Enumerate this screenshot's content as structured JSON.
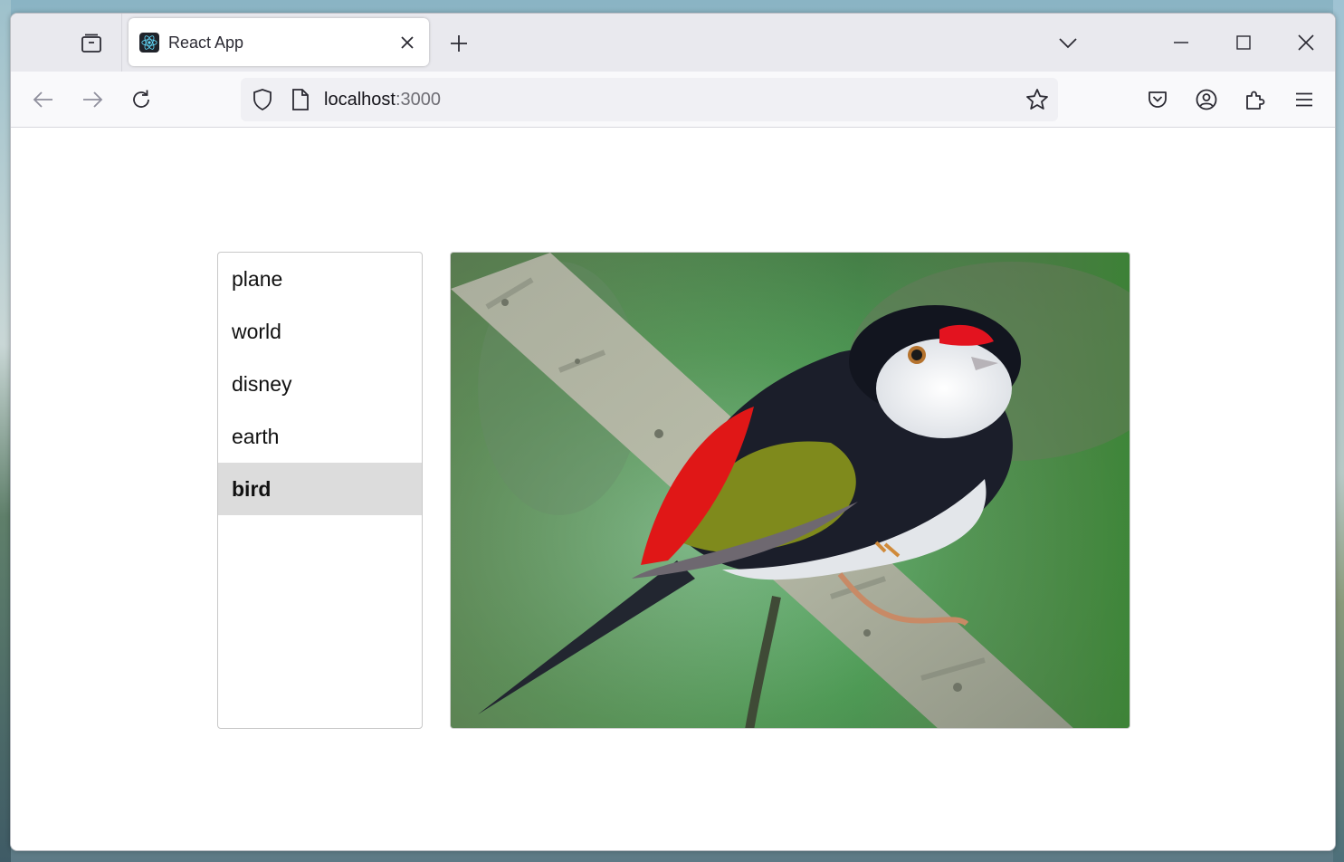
{
  "browser": {
    "tab": {
      "title": "React App",
      "favicon": "react-icon"
    },
    "url": {
      "host": "localhost",
      "port": ":3000"
    },
    "icons": [
      "tab-overview-icon",
      "close-icon",
      "plus-icon",
      "chevron-down-icon",
      "minimize-icon",
      "maximize-icon",
      "close-window-icon",
      "back-arrow-icon",
      "forward-arrow-icon",
      "reload-icon",
      "shield-icon",
      "page-icon",
      "star-icon",
      "pocket-icon",
      "account-icon",
      "extensions-icon",
      "menu-icon"
    ]
  },
  "app": {
    "items": [
      {
        "label": "plane"
      },
      {
        "label": "world"
      },
      {
        "label": "disney"
      },
      {
        "label": "earth"
      },
      {
        "label": "bird"
      }
    ],
    "selected": "bird"
  }
}
